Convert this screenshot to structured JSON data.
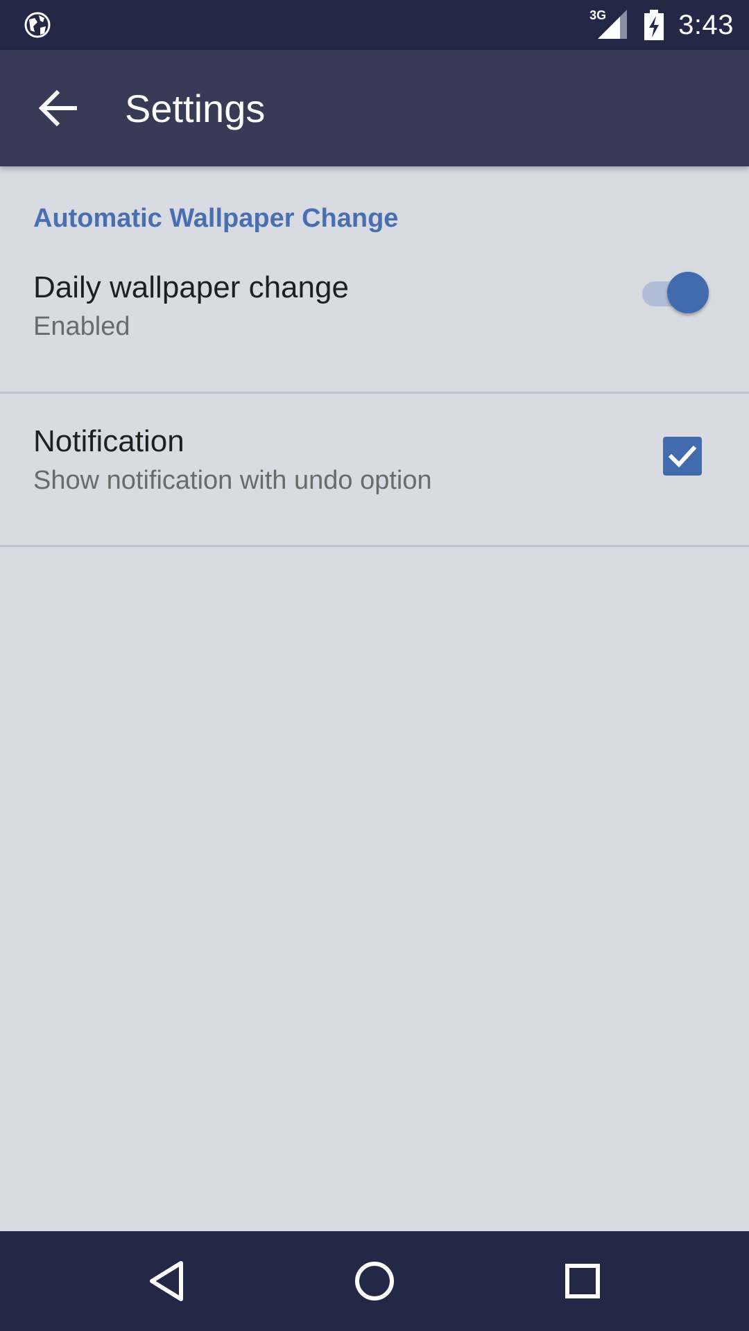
{
  "status_bar": {
    "left_icon": "globe-icon",
    "network_label": "3G",
    "signal_icon": "signal-icon",
    "battery_icon": "battery-charging-icon",
    "time": "3:43"
  },
  "app_bar": {
    "back_icon": "arrow-left-icon",
    "title": "Settings"
  },
  "settings": {
    "section_title": "Automatic Wallpaper Change",
    "items": [
      {
        "title": "Daily wallpaper change",
        "summary": "Enabled",
        "control": "switch",
        "checked": true
      },
      {
        "title": "Notification",
        "summary": "Show notification with undo option",
        "control": "checkbox",
        "checked": true
      }
    ]
  },
  "nav_bar": {
    "back_icon": "triangle-back-icon",
    "home_icon": "circle-home-icon",
    "recents_icon": "square-recents-icon"
  },
  "colors": {
    "status_bar_bg": "#222845",
    "app_bar_bg": "#373b55",
    "content_bg": "#d9dbe3",
    "accent": "#416bad",
    "section_header": "#4a6fb0"
  }
}
